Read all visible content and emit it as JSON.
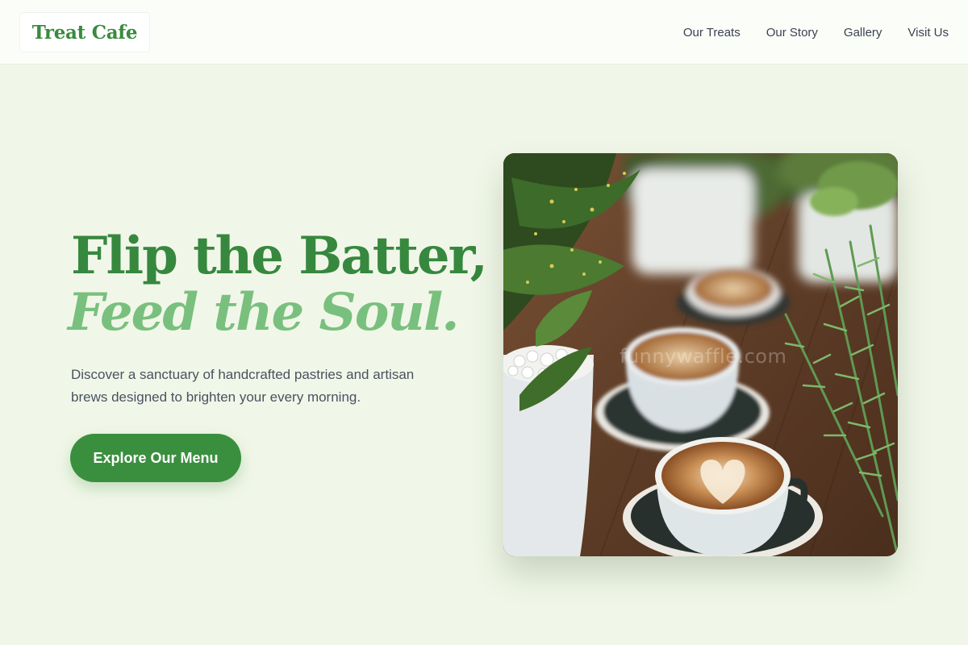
{
  "brand": {
    "name": "Treat Cafe",
    "color": "#3a8a3f"
  },
  "nav": {
    "items": [
      {
        "label": "Our Treats"
      },
      {
        "label": "Our Story"
      },
      {
        "label": "Gallery"
      },
      {
        "label": "Visit Us"
      }
    ]
  },
  "hero": {
    "title": "Flip the Batter,",
    "subtitle": "Feed the Soul.",
    "description": "Discover a sanctuary of handcrafted pastries and artisan brews designed to brighten your every morning.",
    "cta_label": "Explore Our Menu",
    "image_watermark": "funnywaffle.com"
  },
  "colors": {
    "background": "#f1f7e8",
    "primary": "#3a8f3f",
    "accent_light": "#79c07e",
    "text": "#4a5160"
  }
}
